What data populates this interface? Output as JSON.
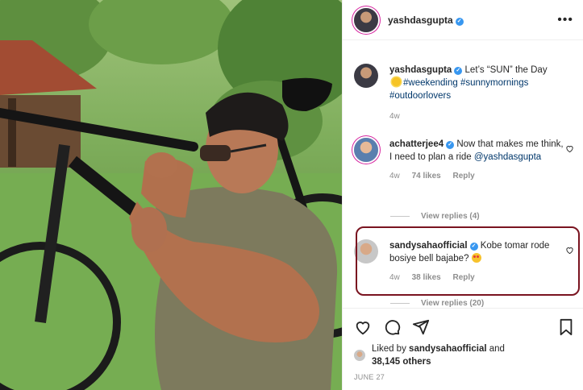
{
  "header": {
    "username": "yashdasgupta",
    "more_icon": "more-icon"
  },
  "caption": {
    "username": "yashdasgupta",
    "text_before": "Let’s “SUN” the Day",
    "hashtags": "#weekending #sunnymornings #outdoorlovers",
    "age": "4w"
  },
  "comments": [
    {
      "username": "achatterjee4",
      "text": "Now that makes me think, I need to plan a ride",
      "mention": "@yashdasgupta",
      "age": "4w",
      "likes": "74 likes",
      "reply": "Reply",
      "view_replies": "View replies (4)"
    },
    {
      "username": "sandysahaofficial",
      "text": "Kobe tomar rode bosiye bell bajabe?",
      "age": "4w",
      "likes": "38 likes",
      "reply": "Reply",
      "view_replies": "View replies (20)"
    }
  ],
  "liked_by": {
    "prefix": "Liked by",
    "user": "sandysahaofficial",
    "and": "and",
    "others": "38,145 others"
  },
  "date": "JUNE 27",
  "colors": {
    "highlight": "#7a1420",
    "verified": "#3897f0",
    "hashtag": "#00376b"
  }
}
